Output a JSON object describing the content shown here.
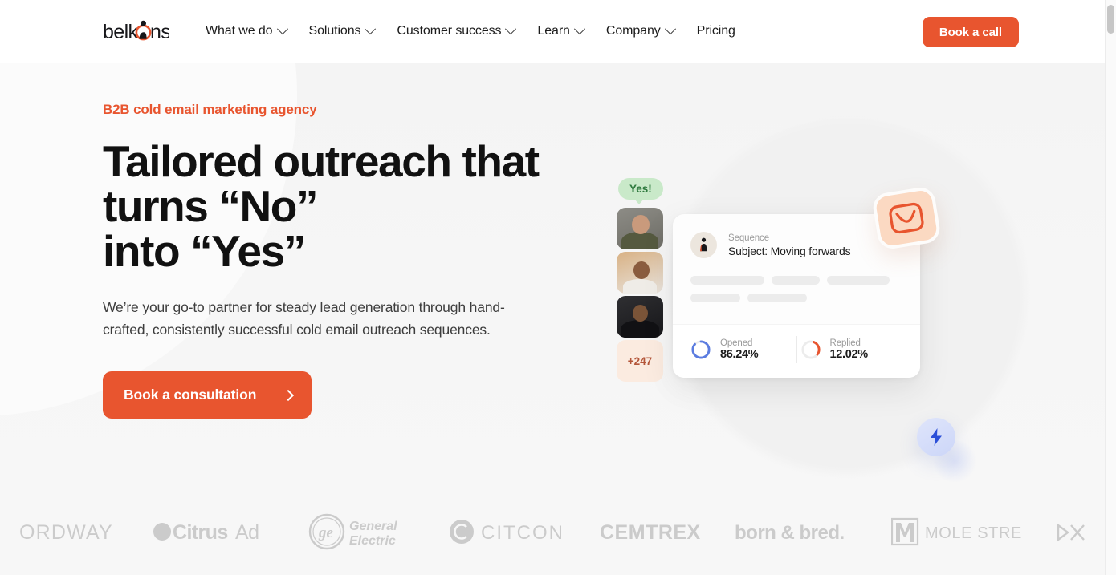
{
  "header": {
    "logo_text": "belkons",
    "logo_name": "belkins-logo",
    "nav": [
      {
        "label": "What we do",
        "has_dropdown": true
      },
      {
        "label": "Solutions",
        "has_dropdown": true
      },
      {
        "label": "Customer success",
        "has_dropdown": true
      },
      {
        "label": "Learn",
        "has_dropdown": true
      },
      {
        "label": "Company",
        "has_dropdown": true
      },
      {
        "label": "Pricing",
        "has_dropdown": false
      }
    ],
    "cta_label": "Book a call"
  },
  "hero": {
    "eyebrow": "B2B cold email marketing agency",
    "headline_line1": "Tailored outreach that",
    "headline_line2": "turns “No”",
    "headline_line3": "into “Yes”",
    "subcopy": "We’re your go-to partner for steady lead generation through hand-crafted, consistently successful cold email outreach sequences.",
    "cta_label": "Book a consultation",
    "cta_arrow": "chevron-right-icon"
  },
  "illustration": {
    "bubble_label": "Yes!",
    "avatar_more_label": "+247",
    "card": {
      "eyebrow": "Sequence",
      "subject": "Subject: Moving forwards",
      "avatar_icon": "belkins-mark-icon",
      "stats": [
        {
          "name": "Opened",
          "value": "86.24%",
          "percent": 86.24,
          "color": "#5b7ce0"
        },
        {
          "name": "Replied",
          "value": "12.02%",
          "percent": 12.02,
          "color": "#e8552f"
        }
      ]
    },
    "mail_badge_icon": "envelope-icon",
    "bolt_badge_icon": "lightning-bolt-icon"
  },
  "clients": [
    {
      "name": "ORDWAY"
    },
    {
      "name": "CitrusAd"
    },
    {
      "name": "General Electric"
    },
    {
      "name": "CITCON"
    },
    {
      "name": "CEMTREX"
    },
    {
      "name": "born & bred."
    },
    {
      "name": "MOLE STREET"
    },
    {
      "name": "DX"
    }
  ],
  "colors": {
    "accent_orange": "#e8552f",
    "hero_background": "#f5f5f5",
    "logo_strip_background": "#f7f7f7",
    "opened_ring": "#5b7ce0",
    "replied_ring": "#e8552f",
    "bubble_green": "#c9e9c9"
  }
}
